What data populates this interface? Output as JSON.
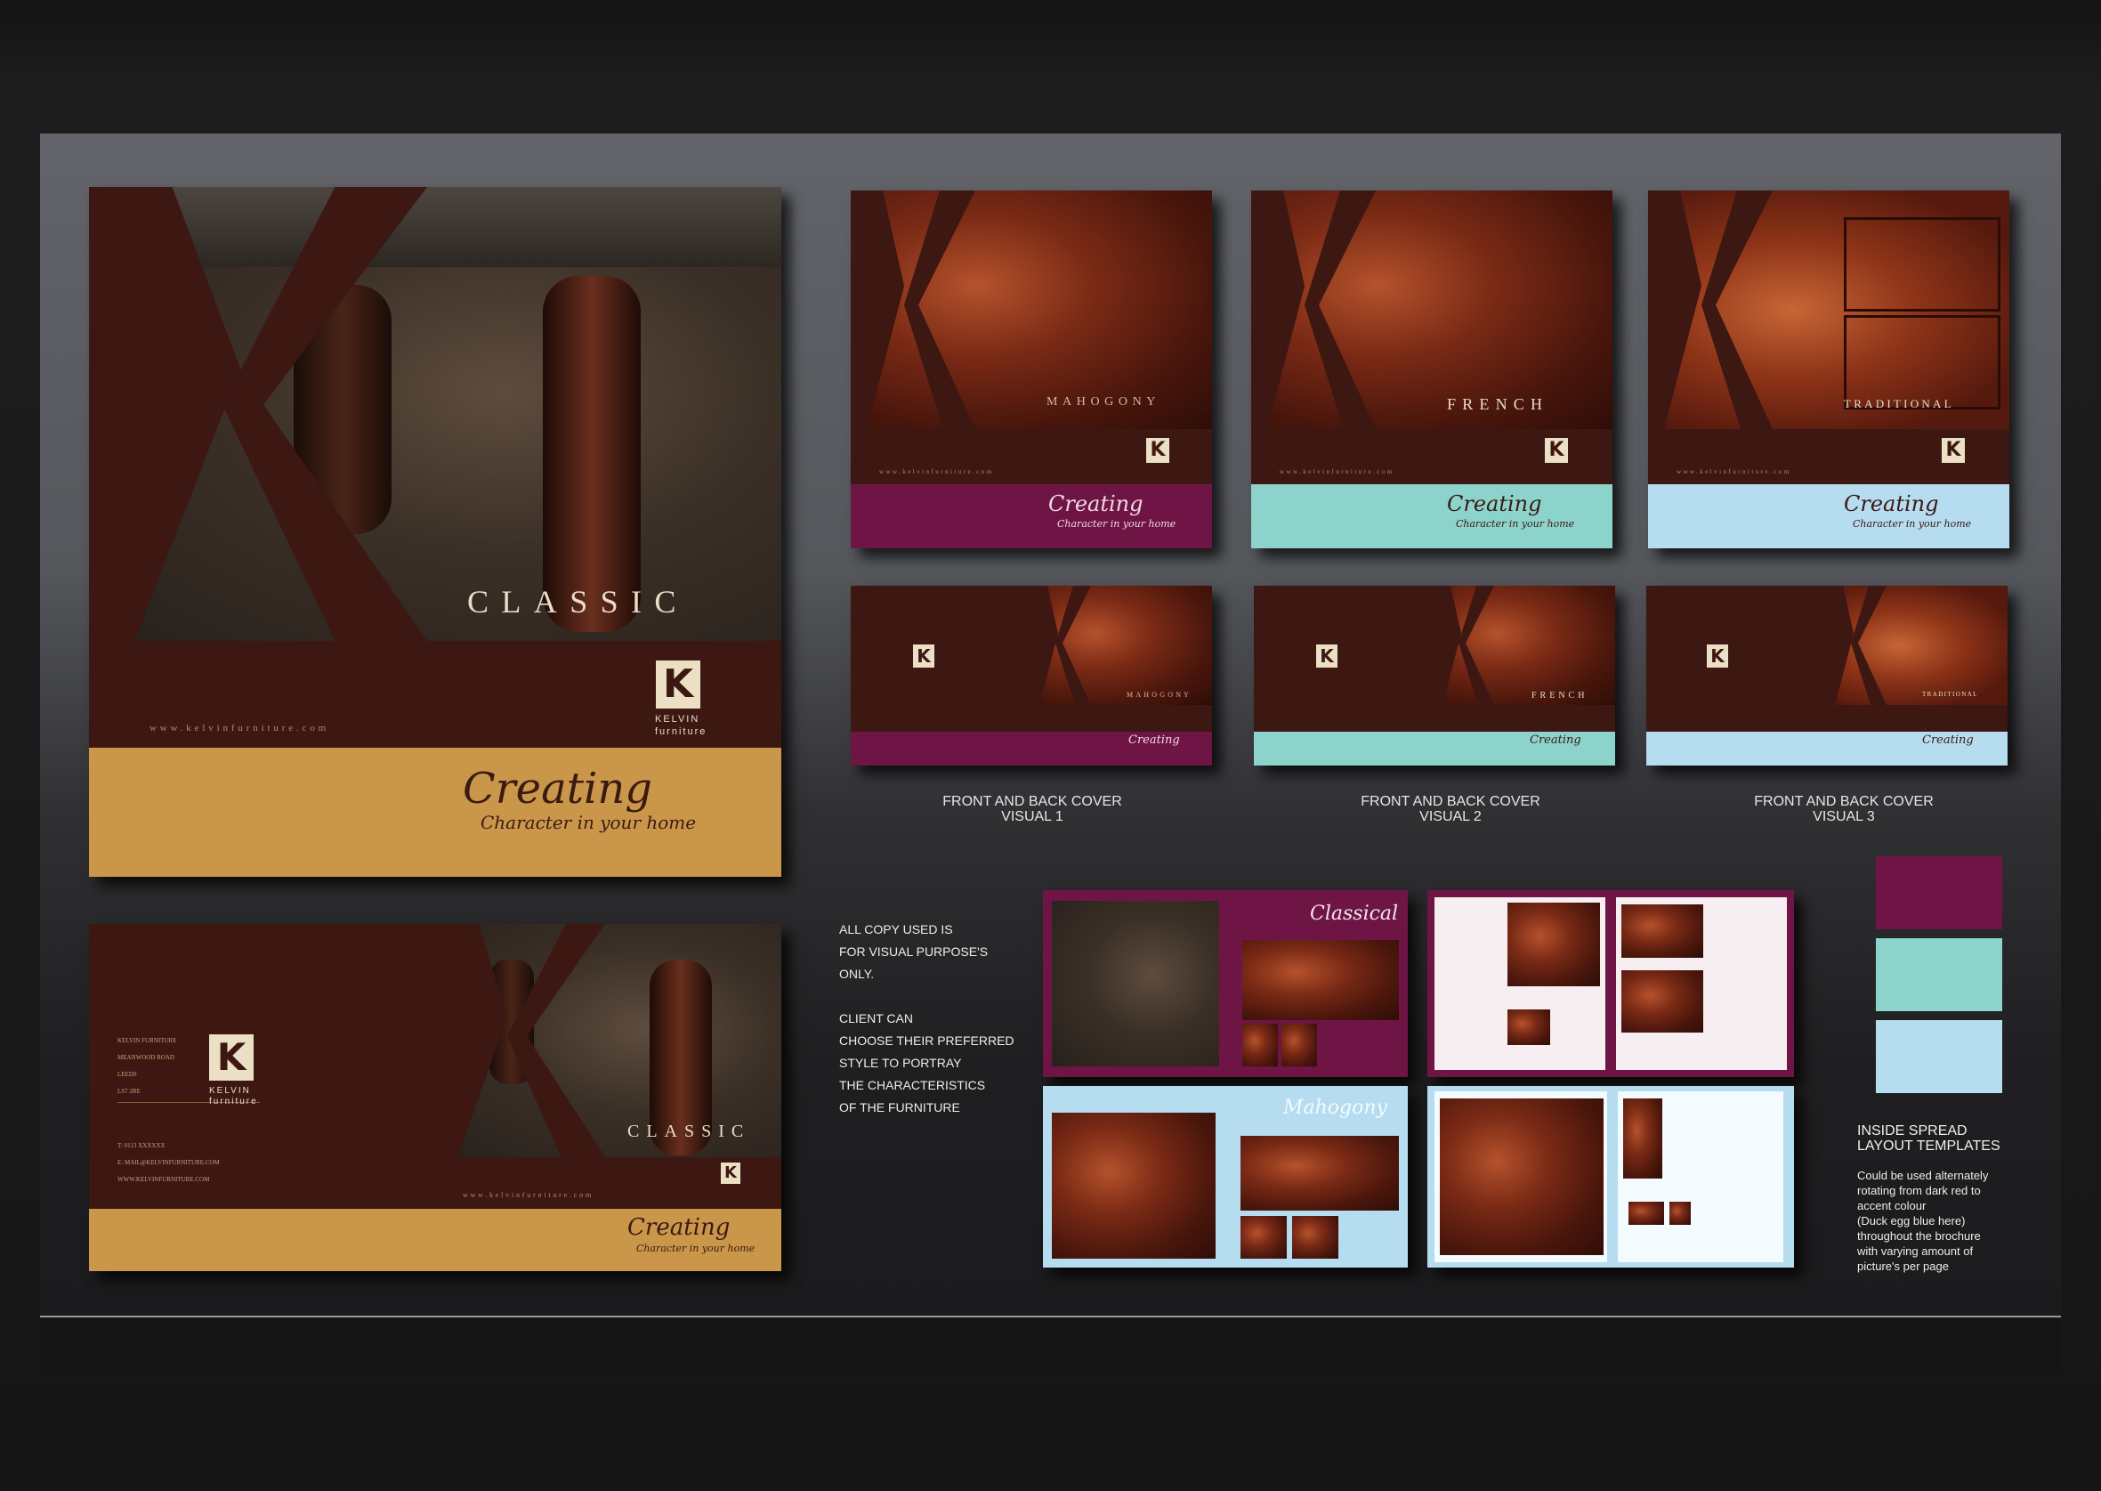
{
  "brand": {
    "logo_letter": "K",
    "logo_name": "KELVIN",
    "logo_sub": "furniture",
    "url": "www.kelvinfurniture.com",
    "tagline_main": "Creating",
    "tagline_sub": "Character in your home"
  },
  "main_cover": {
    "title": "CLASSIC"
  },
  "back_cover": {
    "title": "CLASSIC",
    "address_lines": [
      "KELVIN FURNITURE",
      "MEANWOOD ROAD",
      "LEEDS",
      "LS7 2RE"
    ],
    "contact_lines": [
      "T: 0113 XXXXXX",
      "E: MAIL@KELVINFURNITURE.COM",
      "WWW.KELVINFURNITURE.COM"
    ]
  },
  "visuals": [
    {
      "title": "MAHOGONY",
      "label_line1": "FRONT AND BACK COVER",
      "label_line2": "VISUAL 1",
      "accent": "#6e1545"
    },
    {
      "title": "FRENCH",
      "label_line1": "FRONT AND BACK COVER",
      "label_line2": "VISUAL 2",
      "accent": "#8cd3cc"
    },
    {
      "title": "TRADITIONAL",
      "label_line1": "FRONT AND BACK COVER",
      "label_line2": "VISUAL 3",
      "accent": "#b5dcef"
    }
  ],
  "notes": {
    "copy_note": [
      "ALL COPY USED IS",
      "FOR VISUAL PURPOSE'S",
      "ONLY."
    ],
    "client_note": [
      "CLIENT CAN",
      "CHOOSE THEIR PREFERRED",
      "STYLE TO PORTRAY",
      "THE CHARACTERISTICS",
      "OF THE FURNITURE"
    ]
  },
  "spreads": {
    "classical_title": "Classical",
    "mahogony_title": "Mahogony",
    "heading": [
      "INSIDE SPREAD",
      "LAYOUT TEMPLATES"
    ],
    "description": [
      "Could be used alternately",
      "rotating from dark red to",
      "accent colour",
      "(Duck egg blue here)",
      "throughout the brochure",
      "with varying amount of",
      "picture's per page"
    ]
  },
  "swatches": [
    "#6e1545",
    "#8cd3cc",
    "#b5dcef"
  ],
  "colors": {
    "maroon": "#3d1712",
    "gold": "#c9964a",
    "cream": "#ece0c4"
  }
}
